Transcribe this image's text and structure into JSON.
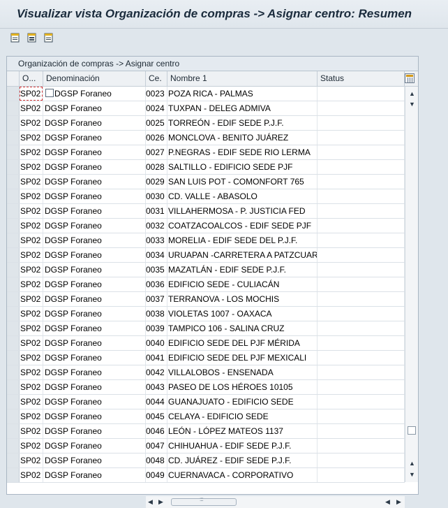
{
  "window": {
    "title": "Visualizar vista Organización de compras -> Asignar centro: Resumen"
  },
  "toolbar": {
    "buttons": [
      {
        "icon": "details-icon"
      },
      {
        "icon": "select-all-icon"
      },
      {
        "icon": "deselect-all-icon"
      }
    ]
  },
  "panel": {
    "title": "Organización de compras -> Asignar centro"
  },
  "table": {
    "columns": [
      {
        "label": "O..."
      },
      {
        "label": "Denominación"
      },
      {
        "label": "Ce."
      },
      {
        "label": "Nombre 1"
      },
      {
        "label": "Status"
      }
    ],
    "rows": [
      {
        "org": "SP02",
        "den": "DGSP Foraneo",
        "ce": "0023",
        "nombre": "POZA RICA - PALMAS",
        "status": ""
      },
      {
        "org": "SP02",
        "den": "DGSP Foraneo",
        "ce": "0024",
        "nombre": "TUXPAN - DELEG ADMIVA",
        "status": ""
      },
      {
        "org": "SP02",
        "den": "DGSP Foraneo",
        "ce": "0025",
        "nombre": "TORREÓN - EDIF SEDE P.J.F.",
        "status": ""
      },
      {
        "org": "SP02",
        "den": "DGSP Foraneo",
        "ce": "0026",
        "nombre": "MONCLOVA - BENITO JUÁREZ",
        "status": ""
      },
      {
        "org": "SP02",
        "den": "DGSP Foraneo",
        "ce": "0027",
        "nombre": "P.NEGRAS - EDIF SEDE RIO LERMA",
        "status": ""
      },
      {
        "org": "SP02",
        "den": "DGSP Foraneo",
        "ce": "0028",
        "nombre": "SALTILLO - EDIFICIO SEDE PJF",
        "status": ""
      },
      {
        "org": "SP02",
        "den": "DGSP Foraneo",
        "ce": "0029",
        "nombre": "SAN LUIS POT - COMONFORT  765",
        "status": ""
      },
      {
        "org": "SP02",
        "den": "DGSP Foraneo",
        "ce": "0030",
        "nombre": "CD. VALLE - ABASOLO",
        "status": ""
      },
      {
        "org": "SP02",
        "den": "DGSP Foraneo",
        "ce": "0031",
        "nombre": "VILLAHERMOSA - P. JUSTICIA FED",
        "status": ""
      },
      {
        "org": "SP02",
        "den": "DGSP Foraneo",
        "ce": "0032",
        "nombre": "COATZACOALCOS - EDIF SEDE PJF",
        "status": ""
      },
      {
        "org": "SP02",
        "den": "DGSP Foraneo",
        "ce": "0033",
        "nombre": "MORELIA - EDIF SEDE DEL P.J.F.",
        "status": ""
      },
      {
        "org": "SP02",
        "den": "DGSP Foraneo",
        "ce": "0034",
        "nombre": "URUAPAN -CARRETERA A PATZCUARO",
        "status": ""
      },
      {
        "org": "SP02",
        "den": "DGSP Foraneo",
        "ce": "0035",
        "nombre": "MAZATLÁN - EDIF SEDE P.J.F.",
        "status": ""
      },
      {
        "org": "SP02",
        "den": "DGSP Foraneo",
        "ce": "0036",
        "nombre": "EDIFICIO SEDE - CULIACÁN",
        "status": ""
      },
      {
        "org": "SP02",
        "den": "DGSP Foraneo",
        "ce": "0037",
        "nombre": "TERRANOVA - LOS MOCHIS",
        "status": ""
      },
      {
        "org": "SP02",
        "den": "DGSP Foraneo",
        "ce": "0038",
        "nombre": "VIOLETAS 1007 - OAXACA",
        "status": ""
      },
      {
        "org": "SP02",
        "den": "DGSP Foraneo",
        "ce": "0039",
        "nombre": "TAMPICO 106 - SALINA CRUZ",
        "status": ""
      },
      {
        "org": "SP02",
        "den": "DGSP Foraneo",
        "ce": "0040",
        "nombre": "EDIFICIO SEDE DEL PJF MÉRIDA",
        "status": ""
      },
      {
        "org": "SP02",
        "den": "DGSP Foraneo",
        "ce": "0041",
        "nombre": "EDIFICIO SEDE DEL PJF MEXICALI",
        "status": ""
      },
      {
        "org": "SP02",
        "den": "DGSP Foraneo",
        "ce": "0042",
        "nombre": "VILLALOBOS - ENSENADA",
        "status": ""
      },
      {
        "org": "SP02",
        "den": "DGSP Foraneo",
        "ce": "0043",
        "nombre": "PASEO DE LOS HÉROES 10105",
        "status": ""
      },
      {
        "org": "SP02",
        "den": "DGSP Foraneo",
        "ce": "0044",
        "nombre": " GUANAJUATO - EDIFICIO SEDE",
        "status": ""
      },
      {
        "org": "SP02",
        "den": "DGSP Foraneo",
        "ce": "0045",
        "nombre": "CELAYA - EDIFICIO SEDE",
        "status": ""
      },
      {
        "org": "SP02",
        "den": "DGSP Foraneo",
        "ce": "0046",
        "nombre": "LEÓN - LÓPEZ MATEOS 1137",
        "status": ""
      },
      {
        "org": "SP02",
        "den": "DGSP Foraneo",
        "ce": "0047",
        "nombre": "CHIHUAHUA - EDIF SEDE P.J.F.",
        "status": ""
      },
      {
        "org": "SP02",
        "den": "DGSP Foraneo",
        "ce": "0048",
        "nombre": "CD. JUÁREZ - EDIF SEDE P.J.F.",
        "status": ""
      },
      {
        "org": "SP02",
        "den": "DGSP Foraneo",
        "ce": "0049",
        "nombre": "CUERNAVACA - CORPORATIVO",
        "status": ""
      }
    ]
  },
  "colors": {
    "background": "#dfe6ec",
    "grid_header": "#eef1f4",
    "focus_border": "#d93a3a"
  }
}
